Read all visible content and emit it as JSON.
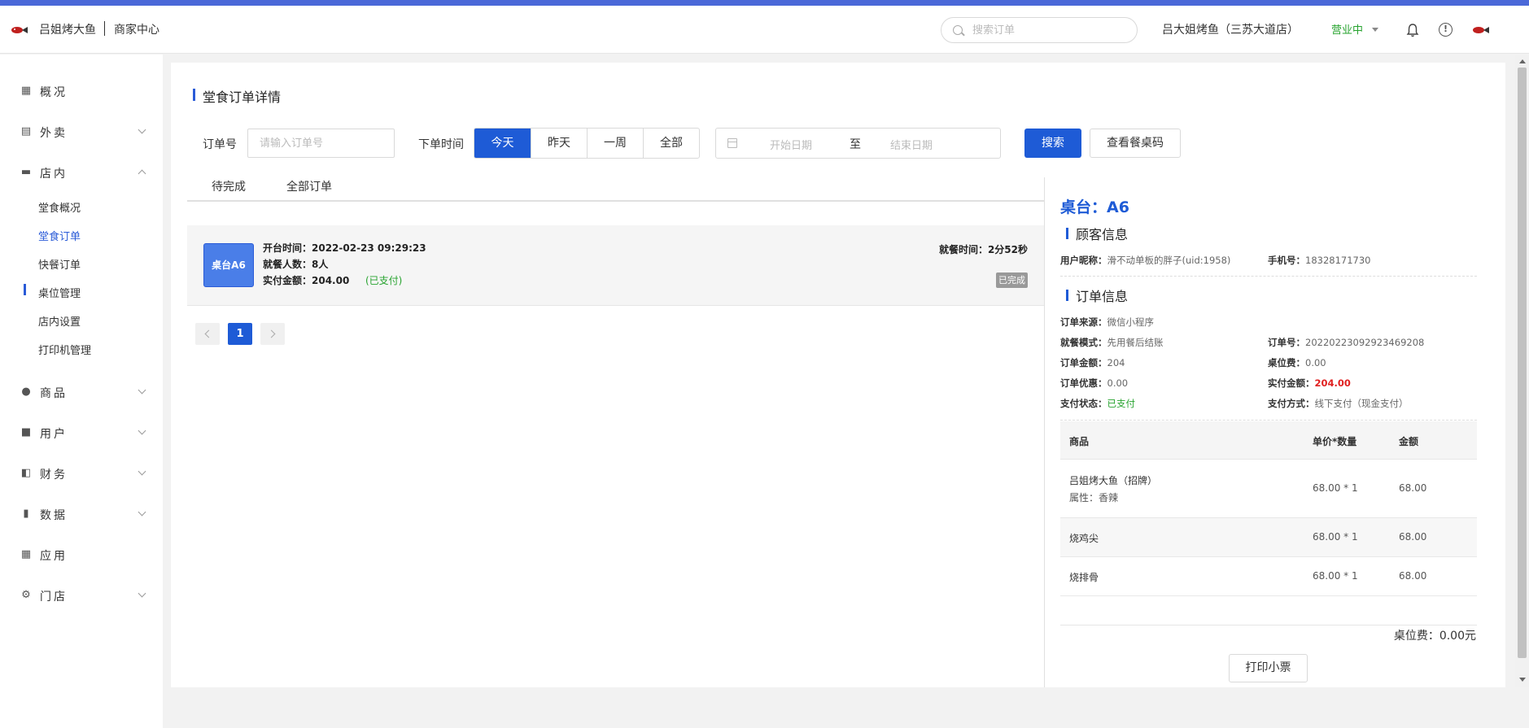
{
  "header": {
    "brand": "吕姐烤大鱼",
    "subtitle": "商家中心",
    "search_placeholder": "搜索订单",
    "store_name": "吕大姐烤鱼（三苏大道店）",
    "status": "营业中",
    "status_color": "#27a32f",
    "icons": [
      "logo-icon",
      "search-icon",
      "bell-icon",
      "info-icon",
      "avatar"
    ]
  },
  "sidebar": {
    "items": [
      {
        "label": "概况",
        "icon": "dashboard-icon"
      },
      {
        "label": "外卖",
        "icon": "takeout-icon"
      },
      {
        "label": "店内",
        "icon": "dine-in-icon"
      },
      {
        "label": "商品",
        "icon": "goods-icon"
      },
      {
        "label": "用户",
        "icon": "user-icon"
      },
      {
        "label": "财务",
        "icon": "wallet-icon"
      },
      {
        "label": "数据",
        "icon": "chart-icon"
      },
      {
        "label": "应用",
        "icon": "apps-icon"
      },
      {
        "label": "门店",
        "icon": "gear-icon"
      }
    ],
    "sub_items": [
      "堂食概况",
      "堂食订单",
      "快餐订单",
      "桌位管理",
      "店内设置",
      "打印机管理"
    ],
    "active_sub": "堂食订单"
  },
  "page": {
    "title": "堂食订单详情",
    "filter": {
      "order_no_label": "订单号",
      "order_no_placeholder": "请输入订单号",
      "time_label": "下单时间",
      "time_options": [
        "今天",
        "昨天",
        "一周",
        "全部"
      ],
      "time_selected": "今天",
      "start_placeholder": "开始日期",
      "range_sep": "至",
      "end_placeholder": "结束日期",
      "search_button": "搜索",
      "view_qr_button": "查看餐桌码"
    },
    "tabs": [
      "待完成",
      "全部订单"
    ],
    "order": {
      "table_badge": "桌台A6",
      "open_time": "开台时间：2022-02-23 09:29:23",
      "guests": "就餐人数：8人",
      "paid_amount": "实付金额：204.00",
      "paid_state": "(已支付)",
      "dining_time": "就餐时间：2分52秒",
      "status": "已完成"
    },
    "pagination": {
      "current": "1"
    }
  },
  "detail": {
    "table_title": "桌台：A6",
    "customer_title": "顾客信息",
    "nickname_label": "用户昵称：",
    "nickname_value": "滑不动单板的胖子(uid:1958)",
    "phone_label": "手机号：",
    "phone_value": "18328171730",
    "order_title": "订单信息",
    "source_label": "订单来源：",
    "source_value": "微信小程序",
    "mode_label": "就餐模式：",
    "mode_value": "先用餐后结账",
    "order_no_label": "订单号：",
    "order_no_value": "20220223092923469208",
    "amount_label": "订单金额：",
    "amount_value": "204",
    "seat_fee_label": "桌位费：",
    "seat_fee_value": "0.00",
    "discount_label": "订单优惠：",
    "discount_value": "0.00",
    "paid_label": "实付金额：",
    "paid_value": "204.00",
    "pay_status_label": "支付状态：",
    "pay_status_value": "已支付",
    "pay_method_label": "支付方式：",
    "pay_method_value": "线下支付（现金支付）",
    "goods_headers": [
      "商品",
      "单价*数量",
      "金额"
    ],
    "goods": [
      {
        "name": "吕姐烤大鱼（招牌）",
        "attr": "属性：香辣",
        "price_qty": "68.00 * 1",
        "amount": "68.00"
      },
      {
        "name": "烧鸡尖",
        "attr": "",
        "price_qty": "68.00 * 1",
        "amount": "68.00"
      },
      {
        "name": "烧排骨",
        "attr": "",
        "price_qty": "68.00 * 1",
        "amount": "68.00"
      }
    ],
    "seat_fee_total": "桌位费：0.00元",
    "print_button": "打印小票"
  },
  "colors": {
    "accent": "#1e5bd6",
    "paid_green": "#27a32f",
    "amount_red": "#e02020"
  }
}
